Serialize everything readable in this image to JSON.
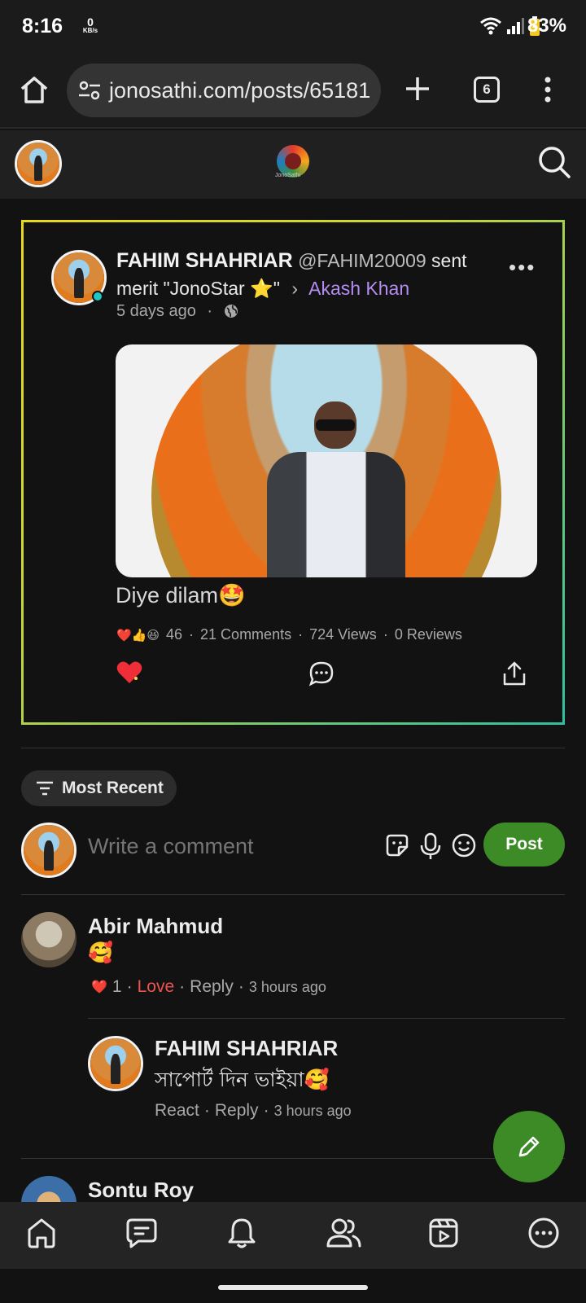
{
  "status_bar": {
    "time": "8:16",
    "net_speed_value": "0",
    "net_speed_unit": "KB/s",
    "battery": "83%"
  },
  "browser": {
    "url": "jonosathi.com/posts/65181",
    "tab_count": "6"
  },
  "site": {
    "logo_text": "JonoSathi"
  },
  "post": {
    "author": "FAHIM SHAHRIAR",
    "handle": "@FAHIM20009",
    "action_text": "sent merit \"JonoStar ⭐\"",
    "chevron": "›",
    "target_user": "Akash Khan",
    "time": "5 days ago",
    "caption": "Diye dilam🤩",
    "reaction_emojis": "❤️👍😆",
    "reaction_count": "46",
    "comments": "21 Comments",
    "views": "724 Views",
    "reviews": "0 Reviews",
    "more_label": "•••"
  },
  "comments_section": {
    "sort_label": "Most Recent",
    "input_placeholder": "Write a comment",
    "post_button": "Post",
    "comments": [
      {
        "name": "Abir Mahmud",
        "text": "🥰",
        "reaction_emoji": "❤️",
        "reaction_count": "1",
        "love_label": "Love",
        "reply_label": "Reply",
        "time": "3 hours ago",
        "replies": [
          {
            "name": "FAHIM SHAHRIAR",
            "text": "সাপোর্ট দিন ভাইয়া🥰",
            "react_label": "React",
            "reply_label": "Reply",
            "time": "3 hours ago"
          }
        ]
      },
      {
        "name": "Sontu Roy"
      }
    ]
  },
  "colors": {
    "accent_green": "#3d8b27",
    "link_purple": "#b48cf0",
    "love_red": "#ef5350",
    "online_teal": "#1ec6c4"
  },
  "icons": {
    "bottom_nav": [
      "home-icon",
      "chat-icon",
      "bell-icon",
      "users-icon",
      "video-icon",
      "more-icon"
    ]
  }
}
